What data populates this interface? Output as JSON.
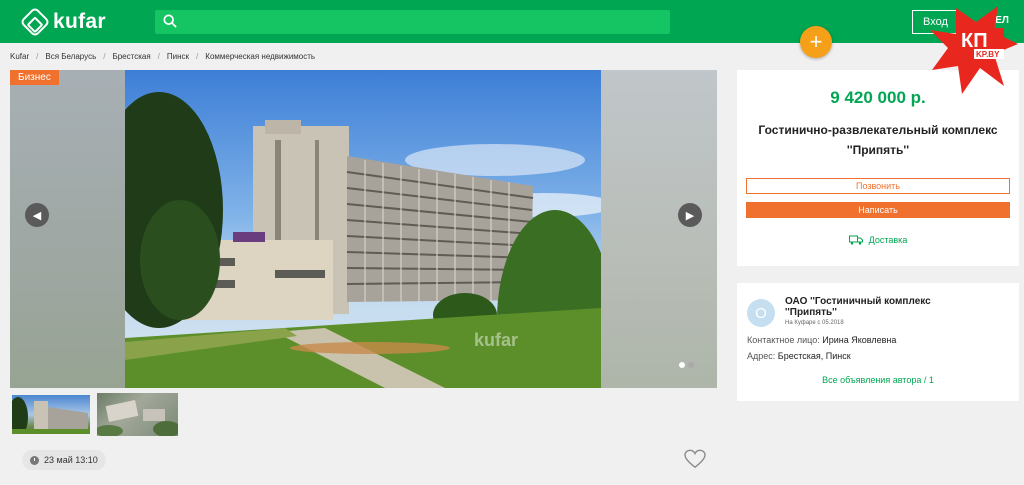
{
  "header": {
    "logo_text": "kufar",
    "search_placeholder": "",
    "login_label": "Вход",
    "lang_label": "БЕЛ",
    "add_label": "+",
    "brand_color": "#00a651",
    "accent_color": "#f6a01a"
  },
  "watermark": {
    "kp_text": "КП",
    "kp_domain": "KP.BY"
  },
  "breadcrumbs": [
    "Kufar",
    "Вся Беларусь",
    "Брестская",
    "Пинск",
    "Коммерческая недвижимость"
  ],
  "gallery": {
    "badge": "Бизнес",
    "prev_icon": "chevron-left-icon",
    "next_icon": "chevron-right-icon",
    "photo_watermark": "kufar",
    "slide_count": 2,
    "active_slide": 1
  },
  "listing": {
    "date": "23 май 13:10",
    "favorite_icon": "heart-icon"
  },
  "price_card": {
    "price": "9 420 000 р.",
    "title": "Гостинично-развлекательный комплекс ''Припять''",
    "call_label": "Позвонить",
    "write_label": "Написать",
    "delivery_label": "Доставка",
    "delivery_icon": "truck-icon",
    "button_color": "#f0702d"
  },
  "seller": {
    "avatar_letter": "О",
    "name": "ОАО ''Гостиничный комплекс ''Припять''",
    "since": "На Куфаре с 05.2018",
    "contact_label": "Контактное лицо:",
    "contact_value": "Ирина Яковлевна",
    "address_label": "Адрес:",
    "address_value": "Брестская, Пинск",
    "all_ads": "Все объявления автора / 1"
  }
}
